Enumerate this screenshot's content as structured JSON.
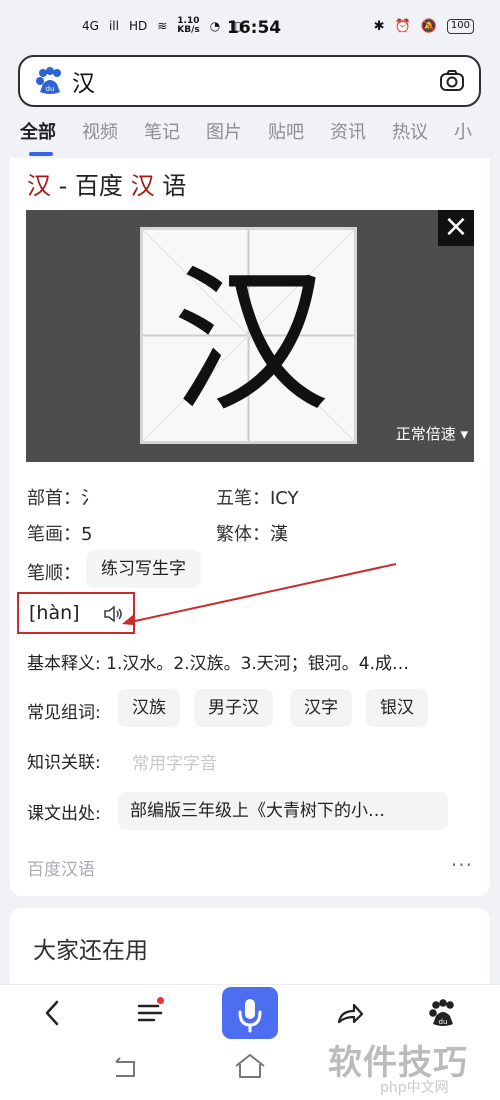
{
  "status": {
    "network": "4G",
    "signal": "ill",
    "hd": "HD",
    "speed_top": "1.10",
    "speed_bottom": "KB/s",
    "time": "16:54",
    "battery": "100"
  },
  "search": {
    "query": "汉",
    "camera_icon": "camera-icon",
    "logo_icon": "baidu-paw-icon"
  },
  "tabs": [
    {
      "label": "全部"
    },
    {
      "label": "视频"
    },
    {
      "label": "笔记"
    },
    {
      "label": "图片"
    },
    {
      "label": "贴吧"
    },
    {
      "label": "资讯"
    },
    {
      "label": "热议"
    },
    {
      "label": "小"
    }
  ],
  "entry": {
    "title_char": "汉",
    "title_separator": " - ",
    "title_brand": "百度",
    "title_brand_char": "汉",
    "title_suffix": "语",
    "video": {
      "character": "汉",
      "close_label": "×",
      "speed_label": "正常倍速 ▾"
    },
    "radical_label": "部首：",
    "radical_value": "氵",
    "wubi_label": "五笔：",
    "wubi_value": "ICY",
    "strokes_label": "笔画：",
    "strokes_value": "5",
    "traditional_label": "繁体：",
    "traditional_value": "漢",
    "order_label": "笔顺：",
    "order_button": "练习写生字",
    "pinyin": "[hàn]",
    "basic_definition": "基本释义: 1.汉水。2.汉族。3.天河；银河。4.成…",
    "common_words_label": "常见组词:",
    "common_words": [
      "汉族",
      "男子汉",
      "汉字",
      "银汉"
    ],
    "related_label": "知识关联:",
    "related_value": "常用字字音",
    "textbook_label": "课文出处:",
    "textbook_value": "部编版三年级上《大青树下的小…",
    "source_label": "百度汉语",
    "more_label": "···"
  },
  "next_card": {
    "title": "大家还在用"
  },
  "bottom_nav": {
    "back_icon": "chevron-left-icon",
    "menu_icon": "menu-icon",
    "voice_icon": "microphone-icon",
    "share_icon": "share-icon",
    "home_icon": "baidu-paw-icon"
  },
  "watermark": {
    "text": "软件技巧",
    "php": "php中文网"
  },
  "colors": {
    "accent": "#4e6ef2",
    "red": "#c72d2d",
    "dark_red": "#a41818"
  }
}
